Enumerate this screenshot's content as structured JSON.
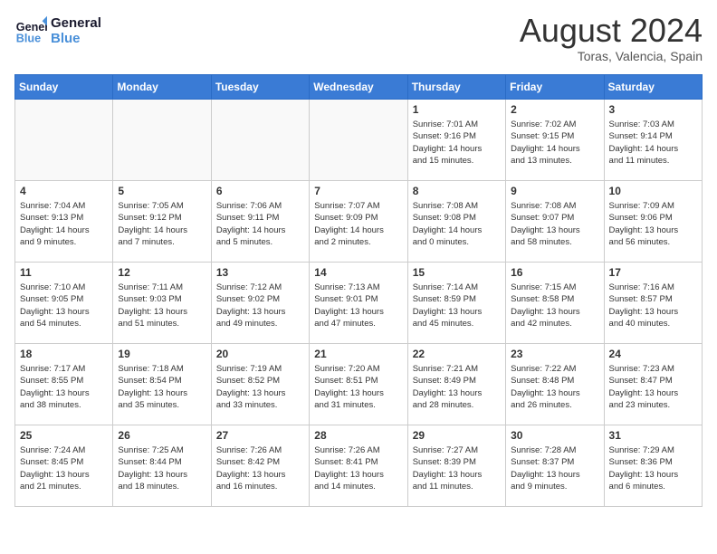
{
  "header": {
    "logo_line1": "General",
    "logo_line2": "Blue",
    "month_title": "August 2024",
    "location": "Toras, Valencia, Spain"
  },
  "days_of_week": [
    "Sunday",
    "Monday",
    "Tuesday",
    "Wednesday",
    "Thursday",
    "Friday",
    "Saturday"
  ],
  "weeks": [
    [
      {
        "day": "",
        "info": "",
        "empty": true
      },
      {
        "day": "",
        "info": "",
        "empty": true
      },
      {
        "day": "",
        "info": "",
        "empty": true
      },
      {
        "day": "",
        "info": "",
        "empty": true
      },
      {
        "day": "1",
        "info": "Sunrise: 7:01 AM\nSunset: 9:16 PM\nDaylight: 14 hours\nand 15 minutes."
      },
      {
        "day": "2",
        "info": "Sunrise: 7:02 AM\nSunset: 9:15 PM\nDaylight: 14 hours\nand 13 minutes."
      },
      {
        "day": "3",
        "info": "Sunrise: 7:03 AM\nSunset: 9:14 PM\nDaylight: 14 hours\nand 11 minutes."
      }
    ],
    [
      {
        "day": "4",
        "info": "Sunrise: 7:04 AM\nSunset: 9:13 PM\nDaylight: 14 hours\nand 9 minutes."
      },
      {
        "day": "5",
        "info": "Sunrise: 7:05 AM\nSunset: 9:12 PM\nDaylight: 14 hours\nand 7 minutes."
      },
      {
        "day": "6",
        "info": "Sunrise: 7:06 AM\nSunset: 9:11 PM\nDaylight: 14 hours\nand 5 minutes."
      },
      {
        "day": "7",
        "info": "Sunrise: 7:07 AM\nSunset: 9:09 PM\nDaylight: 14 hours\nand 2 minutes."
      },
      {
        "day": "8",
        "info": "Sunrise: 7:08 AM\nSunset: 9:08 PM\nDaylight: 14 hours\nand 0 minutes."
      },
      {
        "day": "9",
        "info": "Sunrise: 7:08 AM\nSunset: 9:07 PM\nDaylight: 13 hours\nand 58 minutes."
      },
      {
        "day": "10",
        "info": "Sunrise: 7:09 AM\nSunset: 9:06 PM\nDaylight: 13 hours\nand 56 minutes."
      }
    ],
    [
      {
        "day": "11",
        "info": "Sunrise: 7:10 AM\nSunset: 9:05 PM\nDaylight: 13 hours\nand 54 minutes."
      },
      {
        "day": "12",
        "info": "Sunrise: 7:11 AM\nSunset: 9:03 PM\nDaylight: 13 hours\nand 51 minutes."
      },
      {
        "day": "13",
        "info": "Sunrise: 7:12 AM\nSunset: 9:02 PM\nDaylight: 13 hours\nand 49 minutes."
      },
      {
        "day": "14",
        "info": "Sunrise: 7:13 AM\nSunset: 9:01 PM\nDaylight: 13 hours\nand 47 minutes."
      },
      {
        "day": "15",
        "info": "Sunrise: 7:14 AM\nSunset: 8:59 PM\nDaylight: 13 hours\nand 45 minutes."
      },
      {
        "day": "16",
        "info": "Sunrise: 7:15 AM\nSunset: 8:58 PM\nDaylight: 13 hours\nand 42 minutes."
      },
      {
        "day": "17",
        "info": "Sunrise: 7:16 AM\nSunset: 8:57 PM\nDaylight: 13 hours\nand 40 minutes."
      }
    ],
    [
      {
        "day": "18",
        "info": "Sunrise: 7:17 AM\nSunset: 8:55 PM\nDaylight: 13 hours\nand 38 minutes."
      },
      {
        "day": "19",
        "info": "Sunrise: 7:18 AM\nSunset: 8:54 PM\nDaylight: 13 hours\nand 35 minutes."
      },
      {
        "day": "20",
        "info": "Sunrise: 7:19 AM\nSunset: 8:52 PM\nDaylight: 13 hours\nand 33 minutes."
      },
      {
        "day": "21",
        "info": "Sunrise: 7:20 AM\nSunset: 8:51 PM\nDaylight: 13 hours\nand 31 minutes."
      },
      {
        "day": "22",
        "info": "Sunrise: 7:21 AM\nSunset: 8:49 PM\nDaylight: 13 hours\nand 28 minutes."
      },
      {
        "day": "23",
        "info": "Sunrise: 7:22 AM\nSunset: 8:48 PM\nDaylight: 13 hours\nand 26 minutes."
      },
      {
        "day": "24",
        "info": "Sunrise: 7:23 AM\nSunset: 8:47 PM\nDaylight: 13 hours\nand 23 minutes."
      }
    ],
    [
      {
        "day": "25",
        "info": "Sunrise: 7:24 AM\nSunset: 8:45 PM\nDaylight: 13 hours\nand 21 minutes."
      },
      {
        "day": "26",
        "info": "Sunrise: 7:25 AM\nSunset: 8:44 PM\nDaylight: 13 hours\nand 18 minutes."
      },
      {
        "day": "27",
        "info": "Sunrise: 7:26 AM\nSunset: 8:42 PM\nDaylight: 13 hours\nand 16 minutes."
      },
      {
        "day": "28",
        "info": "Sunrise: 7:26 AM\nSunset: 8:41 PM\nDaylight: 13 hours\nand 14 minutes."
      },
      {
        "day": "29",
        "info": "Sunrise: 7:27 AM\nSunset: 8:39 PM\nDaylight: 13 hours\nand 11 minutes."
      },
      {
        "day": "30",
        "info": "Sunrise: 7:28 AM\nSunset: 8:37 PM\nDaylight: 13 hours\nand 9 minutes."
      },
      {
        "day": "31",
        "info": "Sunrise: 7:29 AM\nSunset: 8:36 PM\nDaylight: 13 hours\nand 6 minutes."
      }
    ]
  ]
}
